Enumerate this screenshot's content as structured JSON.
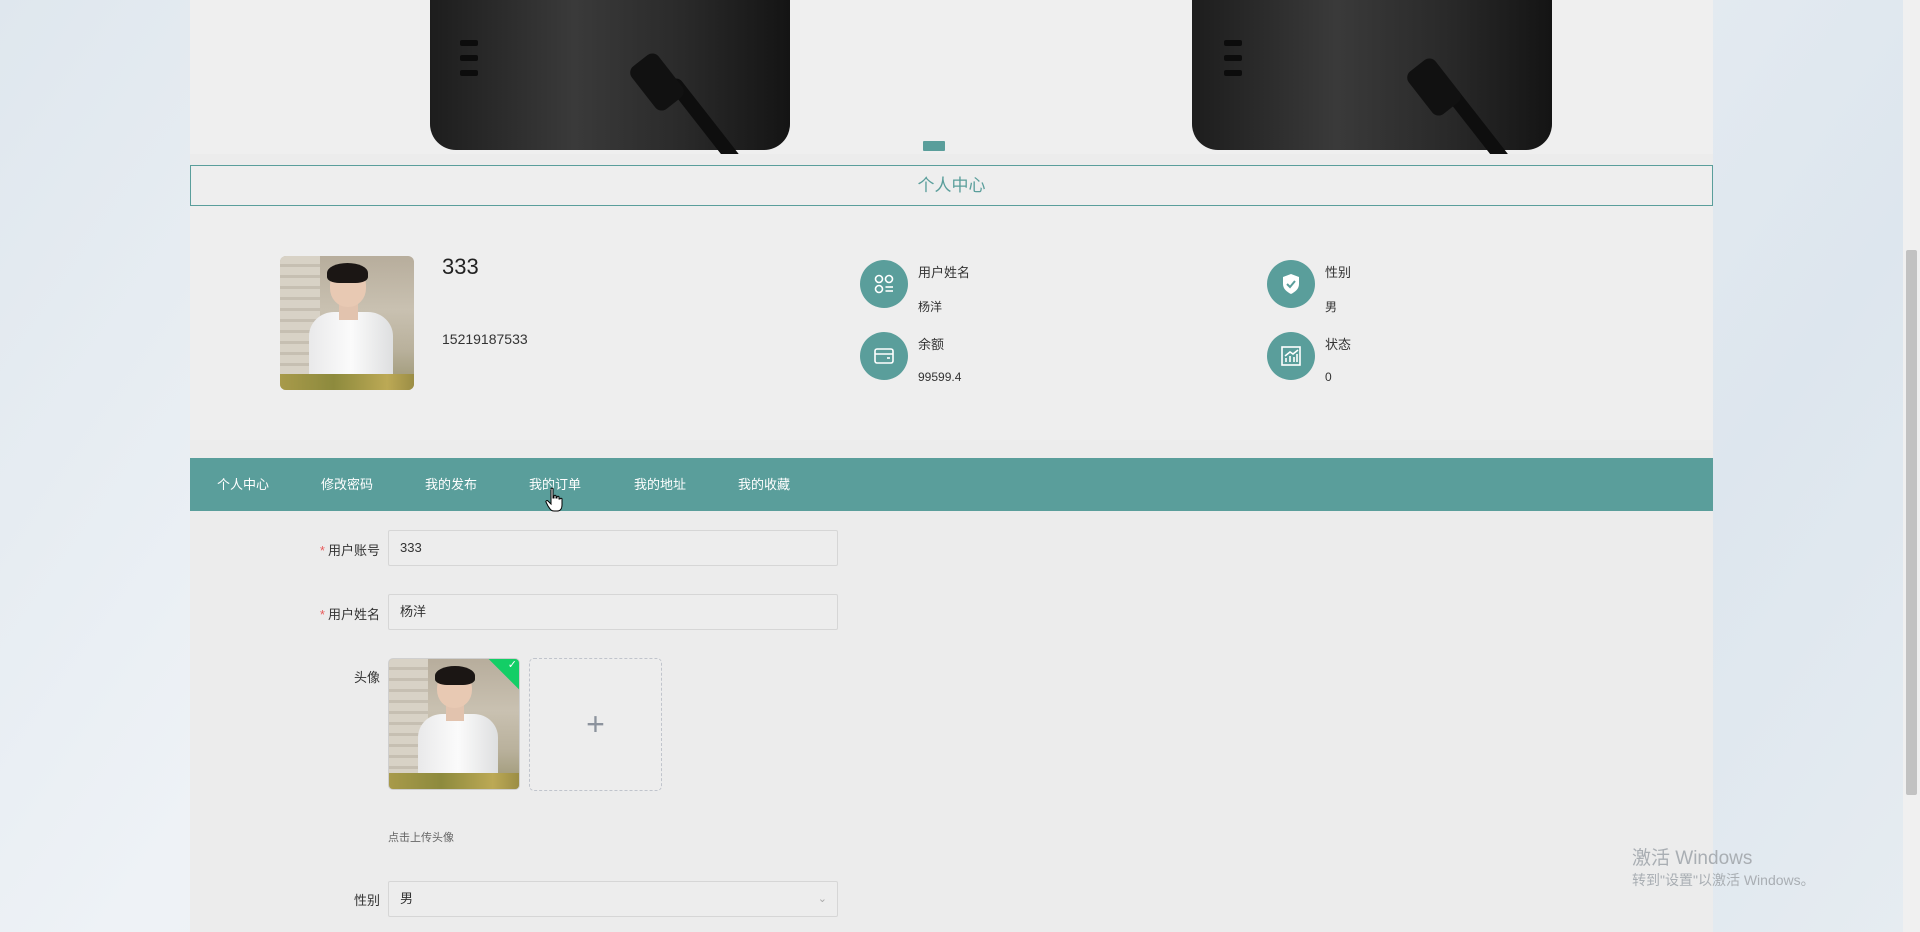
{
  "section_title": "个人中心",
  "profile": {
    "name": "333",
    "phone": "15219187533",
    "fields": [
      {
        "label": "用户姓名",
        "value": "杨洋",
        "icon": "user-grid-icon"
      },
      {
        "label": "性别",
        "value": "男",
        "icon": "shield-check-icon"
      },
      {
        "label": "余额",
        "value": "99599.4",
        "icon": "wallet-icon"
      },
      {
        "label": "状态",
        "value": "0",
        "icon": "chart-icon"
      }
    ]
  },
  "tabs": [
    "个人中心",
    "修改密码",
    "我的发布",
    "我的订单",
    "我的地址",
    "我的收藏"
  ],
  "form": {
    "account_label": "用户账号",
    "account_value": "333",
    "name_label": "用户姓名",
    "name_value": "杨洋",
    "avatar_label": "头像",
    "upload_hint": "点击上传头像",
    "upload_plus": "+",
    "gender_label": "性别",
    "gender_value": "男"
  },
  "watermark": {
    "line1": "激活 Windows",
    "line2": "转到\"设置\"以激活 Windows。"
  },
  "colors": {
    "accent": "#5a9e9b",
    "success": "#13ce66",
    "required": "#e85b5b"
  }
}
